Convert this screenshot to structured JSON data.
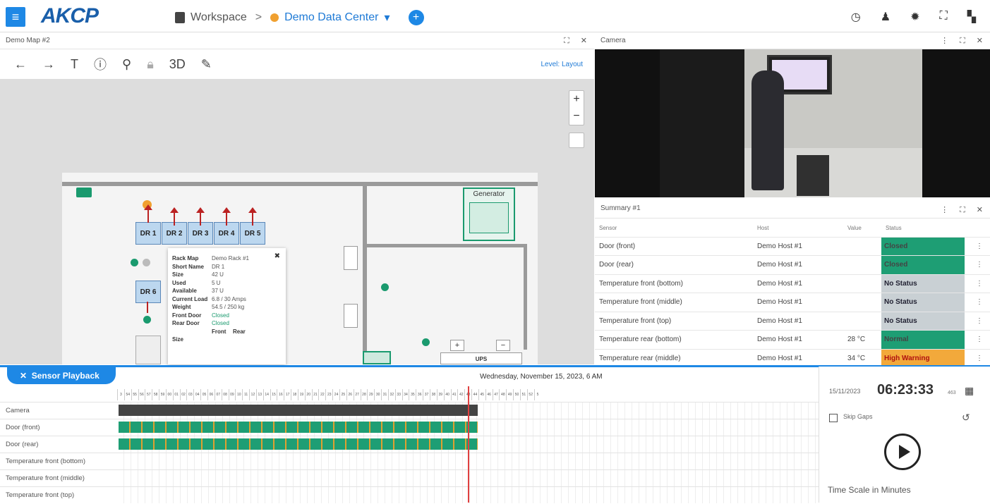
{
  "app": {
    "logo": "AKCP"
  },
  "breadcrumb": {
    "workspace": "Workspace",
    "separator": ">",
    "datacenter": "Demo Data Center"
  },
  "map_panel": {
    "title": "Demo Map #2",
    "toolbar_3d": "3D",
    "level_label": "Level: Layout"
  },
  "floor": {
    "racks_top": [
      "DR 1",
      "DR 2",
      "DR 3",
      "DR 4",
      "DR 5"
    ],
    "rack_bottom": "DR 6",
    "generator_label": "Generator",
    "ups_label": "UPS"
  },
  "popup": {
    "rows": [
      {
        "k": "Rack Map",
        "v": "Demo Rack #1"
      },
      {
        "k": "Short Name",
        "v": "DR 1"
      },
      {
        "k": "Size",
        "v": "42 U"
      },
      {
        "k": "Used",
        "v": "5 U"
      },
      {
        "k": "Available",
        "v": "37 U"
      },
      {
        "k": "Current Load",
        "v": "6.8 / 30 Amps"
      },
      {
        "k": "Weight",
        "v": "54.5 / 250 kg"
      },
      {
        "k": "Front Door",
        "v": "Closed"
      },
      {
        "k": "Rear Door",
        "v": "Closed"
      }
    ],
    "front_label": "Front",
    "rear_label": "Rear",
    "size_label": "Size"
  },
  "camera_panel": {
    "title": "Camera"
  },
  "summary_panel": {
    "title": "Summary #1",
    "columns": [
      "Sensor",
      "Host",
      "Value",
      "Status"
    ],
    "rows": [
      {
        "sensor": "Door (front)",
        "host": "Demo Host #1",
        "value": "",
        "status": "Closed"
      },
      {
        "sensor": "Door (rear)",
        "host": "Demo Host #1",
        "value": "",
        "status": "Closed"
      },
      {
        "sensor": "Temperature front (bottom)",
        "host": "Demo Host #1",
        "value": "",
        "status": "No Status"
      },
      {
        "sensor": "Temperature front (middle)",
        "host": "Demo Host #1",
        "value": "",
        "status": "No Status"
      },
      {
        "sensor": "Temperature front (top)",
        "host": "Demo Host #1",
        "value": "",
        "status": "No Status"
      },
      {
        "sensor": "Temperature rear (bottom)",
        "host": "Demo Host #1",
        "value": "28 °C",
        "status": "Normal"
      },
      {
        "sensor": "Temperature rear (middle)",
        "host": "Demo Host #1",
        "value": "34 °C",
        "status": "High Warning"
      }
    ],
    "status_colors": {
      "Closed": "#1e9e74",
      "Normal": "#1e9e74",
      "No Status": "#c9d0d4",
      "High Warning": "#f2a93b"
    }
  },
  "playback": {
    "tab_label": "Sensor Playback",
    "date_heading": "Wednesday, November 15, 2023, 6 AM",
    "minute_ticks": [
      "3",
      "54",
      "55",
      "56",
      "57",
      "58",
      "59",
      "00",
      "01",
      "02",
      "03",
      "04",
      "05",
      "06",
      "07",
      "08",
      "09",
      "10",
      "11",
      "12",
      "13",
      "14",
      "15",
      "16",
      "17",
      "18",
      "19",
      "20",
      "21",
      "22",
      "23",
      "24",
      "25",
      "26",
      "27",
      "28",
      "29",
      "30",
      "31",
      "32",
      "33",
      "34",
      "35",
      "36",
      "37",
      "38",
      "39",
      "40",
      "41",
      "42",
      "43",
      "44",
      "45",
      "46",
      "47",
      "48",
      "49",
      "50",
      "51",
      "52",
      "5"
    ],
    "rows": [
      "Camera",
      "Door (front)",
      "Door (rear)",
      "Temperature front (bottom)",
      "Temperature front (middle)",
      "Temperature front (top)"
    ],
    "date": "15/11/2023",
    "time": "06:23:33",
    "ms": "463",
    "skip_gaps": "Skip Gaps",
    "time_scale": "Time Scale in Minutes"
  }
}
